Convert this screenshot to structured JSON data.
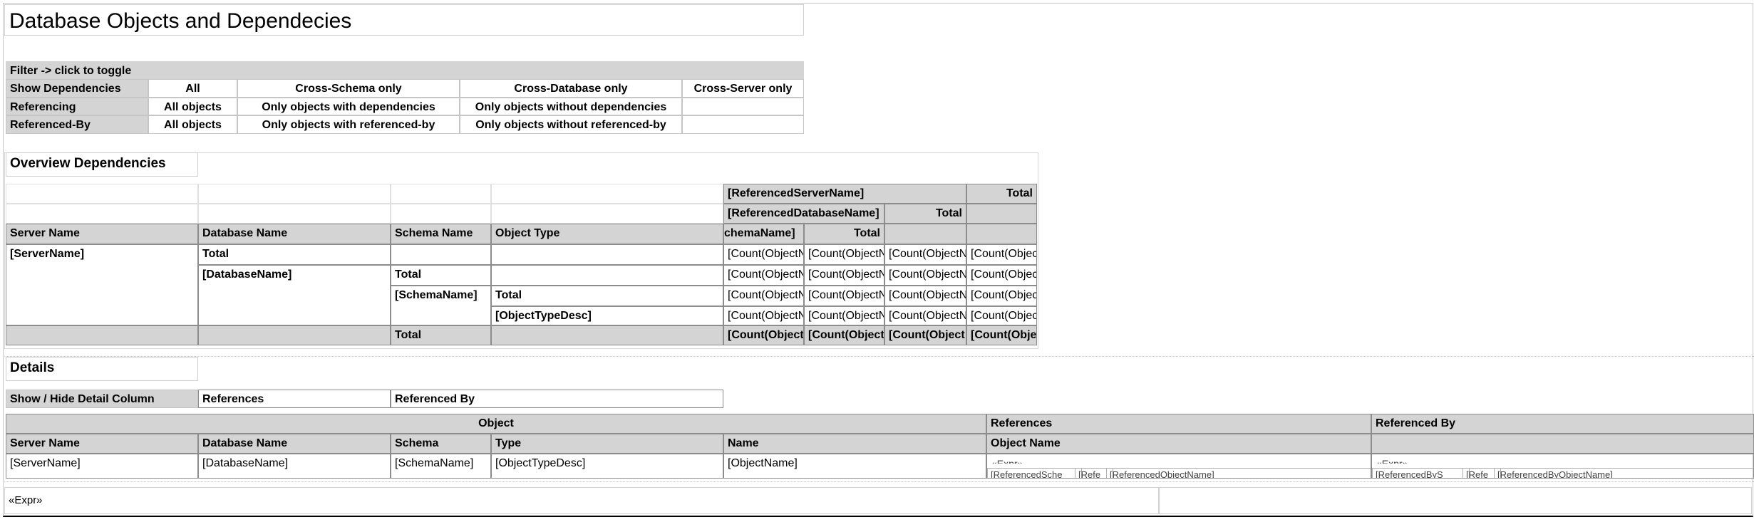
{
  "title": "Database Objects and Dependecies",
  "filter": {
    "header": "Filter  -> click to toggle",
    "rows": [
      {
        "label": "Show Dependencies",
        "options": [
          "All",
          "Cross-Schema only",
          "Cross-Database only",
          "Cross-Server only"
        ]
      },
      {
        "label": "Referencing",
        "options": [
          "All objects",
          "Only objects with dependencies",
          "Only objects without dependencies",
          ""
        ]
      },
      {
        "label": "Referenced-By",
        "options": [
          "All objects",
          "Only objects with referenced-by",
          "Only objects without referenced-by",
          ""
        ]
      }
    ]
  },
  "overview": {
    "heading": "Overview Dependencies",
    "col_headers": [
      "Server Name",
      "Database Name",
      "Schema Name",
      "Object Type"
    ],
    "matrix": {
      "referenced_server": "[ReferencedServerName]",
      "referenced_database": "[ReferencedDatabaseName]",
      "referenced_schema": "chemaName]",
      "total": "Total"
    },
    "rows": {
      "server": "[ServerName]",
      "database": "[DatabaseName]",
      "schema": "[SchemaName]",
      "object_type": "[ObjectTypeDesc]",
      "total": "Total"
    },
    "count_cell": "[Count(ObjectN",
    "count_cell_alt": "[Count(Objec",
    "grand_count_cells": [
      "[Count(Object",
      "[Count(Object",
      "[Count(Object",
      "[Count(Obje"
    ]
  },
  "details": {
    "heading": "Details",
    "toggle": {
      "label": "Show / Hide Detail Column",
      "options": [
        "References",
        "Referenced By"
      ]
    },
    "groups": [
      "Object",
      "References",
      "Referenced By"
    ],
    "col_headers": [
      "Server Name",
      "Database Name",
      "Schema",
      "Type",
      "Name",
      "Object Name"
    ],
    "row": [
      "[ServerName]",
      "[DatabaseName]",
      "[SchemaName]",
      "[ObjectTypeDesc]",
      "[ObjectName]"
    ],
    "references_expr": "«Expr»",
    "references_sub": [
      "[ReferencedSche",
      "[Refe",
      "[ReferencedObjectName]"
    ],
    "referenced_by_expr": "«Expr»",
    "referenced_by_sub": [
      "[ReferencedByS",
      "[Refe",
      "[ReferencedByObjectName]"
    ]
  },
  "footer": {
    "expr": "«Expr»"
  }
}
